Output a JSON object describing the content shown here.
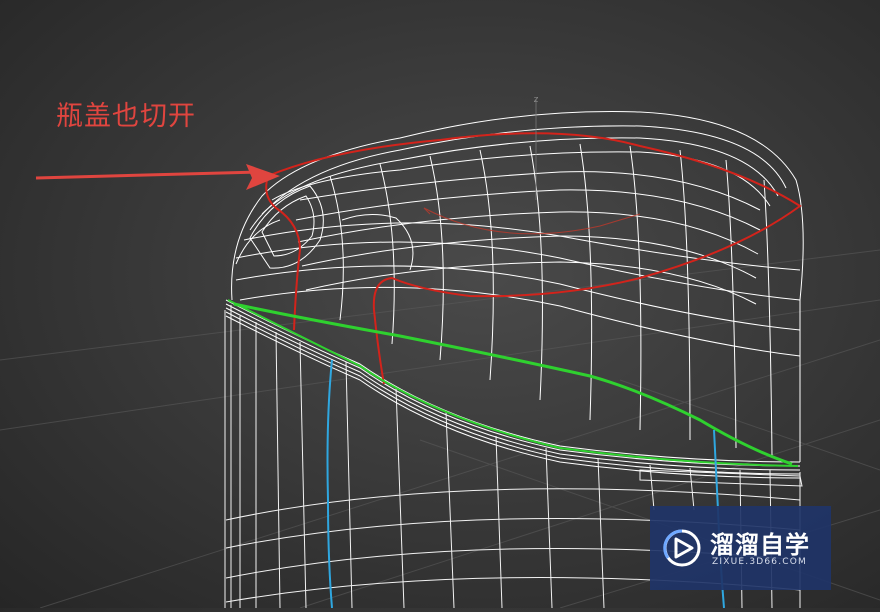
{
  "annotation": {
    "text": "瓶盖也切开"
  },
  "viewport": {
    "axis_gizmo_label": "z",
    "colors": {
      "background": "#3a3a3a",
      "wireframe": "#ffffff",
      "cut_outline": "#d3231b",
      "seam_green": "#2fd12f",
      "seam_blue": "#2fa7e0",
      "arrow": "#e0453f",
      "pivot": "#c0392b"
    }
  },
  "watermark": {
    "title": "溜溜自学",
    "subtitle": "ZIXUE.3D66.COM",
    "logo_icon": "play-icon",
    "background": "#203468"
  }
}
